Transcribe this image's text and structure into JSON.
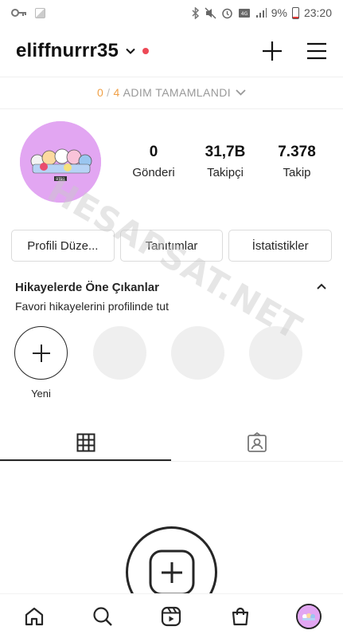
{
  "statusbar": {
    "battery_percent": "9%",
    "time": "23:20",
    "icons": [
      "key-icon",
      "image-icon",
      "bluetooth-icon",
      "mute-icon",
      "alarm-icon",
      "data-icon",
      "signal-icon",
      "battery-icon"
    ]
  },
  "header": {
    "username": "eliffnurrr35",
    "icons": [
      "chevron-down-icon",
      "notification-dot",
      "plus-icon",
      "menu-icon"
    ]
  },
  "steps": {
    "done": "0",
    "separator": "/",
    "total": "4",
    "label": "ADIM TAMAMLANDI"
  },
  "profile": {
    "avatar_text": "BT21",
    "stats": [
      {
        "value": "0",
        "label": "Gönderi"
      },
      {
        "value": "31,7B",
        "label": "Takipçi"
      },
      {
        "value": "7.378",
        "label": "Takip"
      }
    ],
    "buttons": [
      "Profili Düze...",
      "Tanıtımlar",
      "İstatistikler"
    ]
  },
  "highlights": {
    "title": "Hikayelerde Öne Çıkanlar",
    "subtitle": "Favori hikayelerini profilinde tut",
    "new_label": "Yeni"
  },
  "watermark": "HESAPSAT.NET",
  "colors": {
    "accent_orange": "#f0a046",
    "notification_red": "#ed4956",
    "avatar_bg": "#e2a6f2",
    "border": "#dbdbdb"
  },
  "bottom_nav": [
    "home-icon",
    "search-icon",
    "reels-icon",
    "shop-icon",
    "profile-avatar"
  ]
}
